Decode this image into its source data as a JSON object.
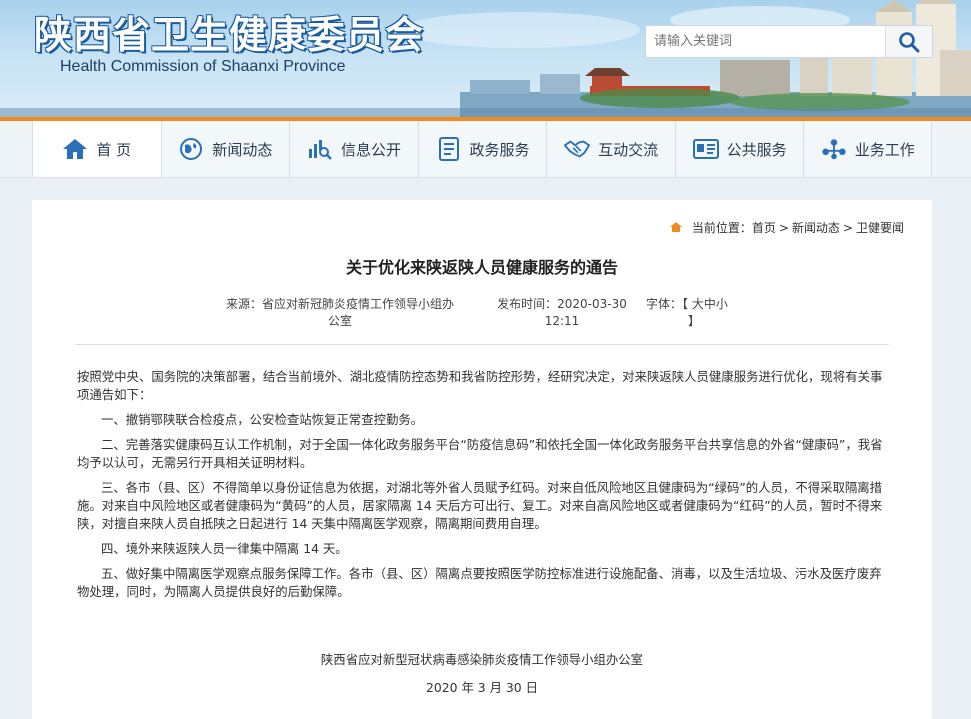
{
  "header": {
    "title_cn": "陕西省卫生健康委员会",
    "title_en": "Health Commission of Shaanxi Province",
    "search_placeholder": "请输入关键词"
  },
  "nav": {
    "items": [
      {
        "label": "首 页",
        "icon": "home-icon"
      },
      {
        "label": "新闻动态",
        "icon": "globe-icon"
      },
      {
        "label": "信息公开",
        "icon": "chart-search-icon"
      },
      {
        "label": "政务服务",
        "icon": "document-list-icon"
      },
      {
        "label": "互动交流",
        "icon": "handshake-icon"
      },
      {
        "label": "公共服务",
        "icon": "id-card-icon"
      },
      {
        "label": "业务工作",
        "icon": "network-icon"
      }
    ]
  },
  "breadcrumb": {
    "prefix": "当前位置：",
    "items": [
      "首页",
      "新闻动态",
      "卫健要闻"
    ],
    "separator": ">"
  },
  "article": {
    "title": "关于优化来陕返陕人员健康服务的通告",
    "source_label": "来源：",
    "source_line1": "省应对新冠肺炎疫情工作领导小组办",
    "source_line2": "公室",
    "time_label": "发布时间：",
    "time_line1": "2020-03-30",
    "time_line2": "12:11",
    "font_label": "字体：",
    "font_open": "【",
    "font_close": "】",
    "font_sizes": [
      "大",
      "中",
      "小"
    ],
    "paragraphs": [
      "按照党中央、国务院的决策部署，结合当前境外、湖北疫情防控态势和我省防控形势，经研究决定，对来陕返陕人员健康服务进行优化，现将有关事项通告如下：",
      "一、撤销鄂陕联合检疫点，公安检查站恢复正常查控勤务。",
      "二、完善落实健康码互认工作机制，对于全国一体化政务服务平台“防疫信息码”和依托全国一体化政务服务平台共享信息的外省“健康码”，我省均予以认可，无需另行开具相关证明材料。",
      "三、各市（县、区）不得简单以身份证信息为依据，对湖北等外省人员赋予红码。对来自低风险地区且健康码为“绿码”的人员，不得采取隔离措施。对来自中风险地区或者健康码为“黄码”的人员，居家隔离 14 天后方可出行、复工。对来自高风险地区或者健康码为“红码”的人员，暂时不得来陕，对擅自来陕人员自抵陕之日起进行 14 天集中隔离医学观察，隔离期间费用自理。",
      "四、境外来陕返陕人员一律集中隔离 14 天。",
      "五、做好集中隔离医学观察点服务保障工作。各市（县、区）隔离点要按照医学防控标准进行设施配备、消毒，以及生活垃圾、污水及医疗废弃物处理，同时，为隔离人员提供良好的后勤保障。"
    ],
    "signature": "陕西省应对新型冠状病毒感染肺炎疫情工作领导小组办公室",
    "date": "2020 年 3 月 30 日"
  },
  "colors": {
    "accent_orange": "#f08a22",
    "brand_blue": "#1a5b9e",
    "nav_icon_blue": "#2a6fb8"
  }
}
